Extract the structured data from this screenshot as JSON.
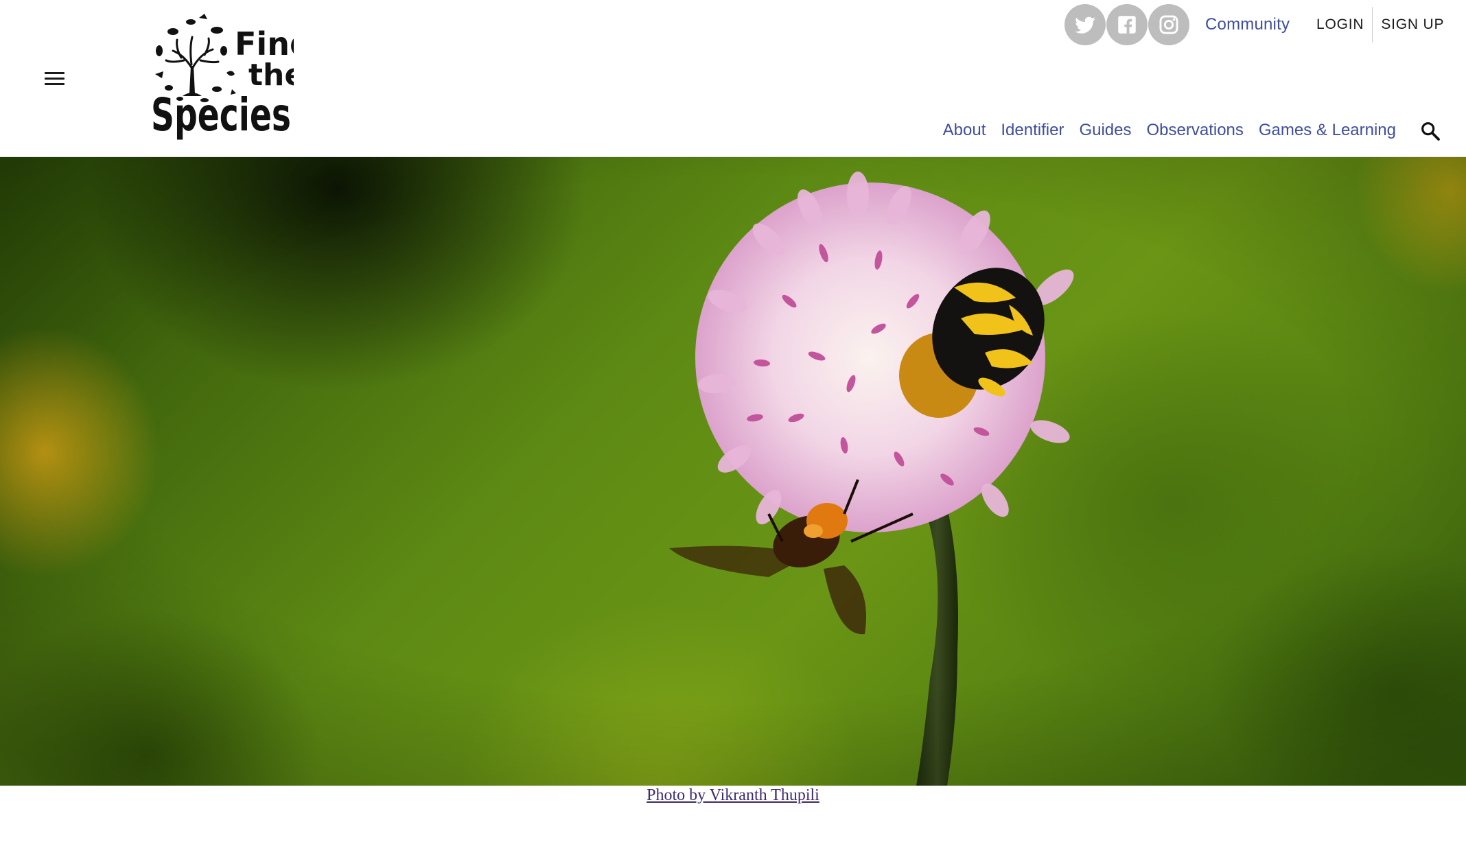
{
  "header": {
    "logo": {
      "line1": "Find",
      "line2": "the",
      "line3": "Species"
    },
    "social": [
      {
        "name": "twitter",
        "icon": "twitter-icon"
      },
      {
        "name": "facebook",
        "icon": "facebook-icon"
      },
      {
        "name": "instagram",
        "icon": "instagram-icon"
      }
    ],
    "community_label": "Community",
    "login_label": "LOGIN",
    "signup_label": "SIGN UP",
    "nav": {
      "about": "About",
      "identifier": "Identifier",
      "guides": "Guides",
      "observations": "Observations",
      "games": "Games & Learning"
    },
    "menu_icon": "hamburger-menu-icon",
    "search_icon": "search-icon"
  },
  "hero": {
    "photo_credit": "Photo by Vikranth Thupili"
  },
  "colors": {
    "nav_link": "#3f4d9e",
    "social_bg": "#bdbdbd",
    "caption_link": "#3d2a6e",
    "text_dark": "#1a1a1a"
  }
}
